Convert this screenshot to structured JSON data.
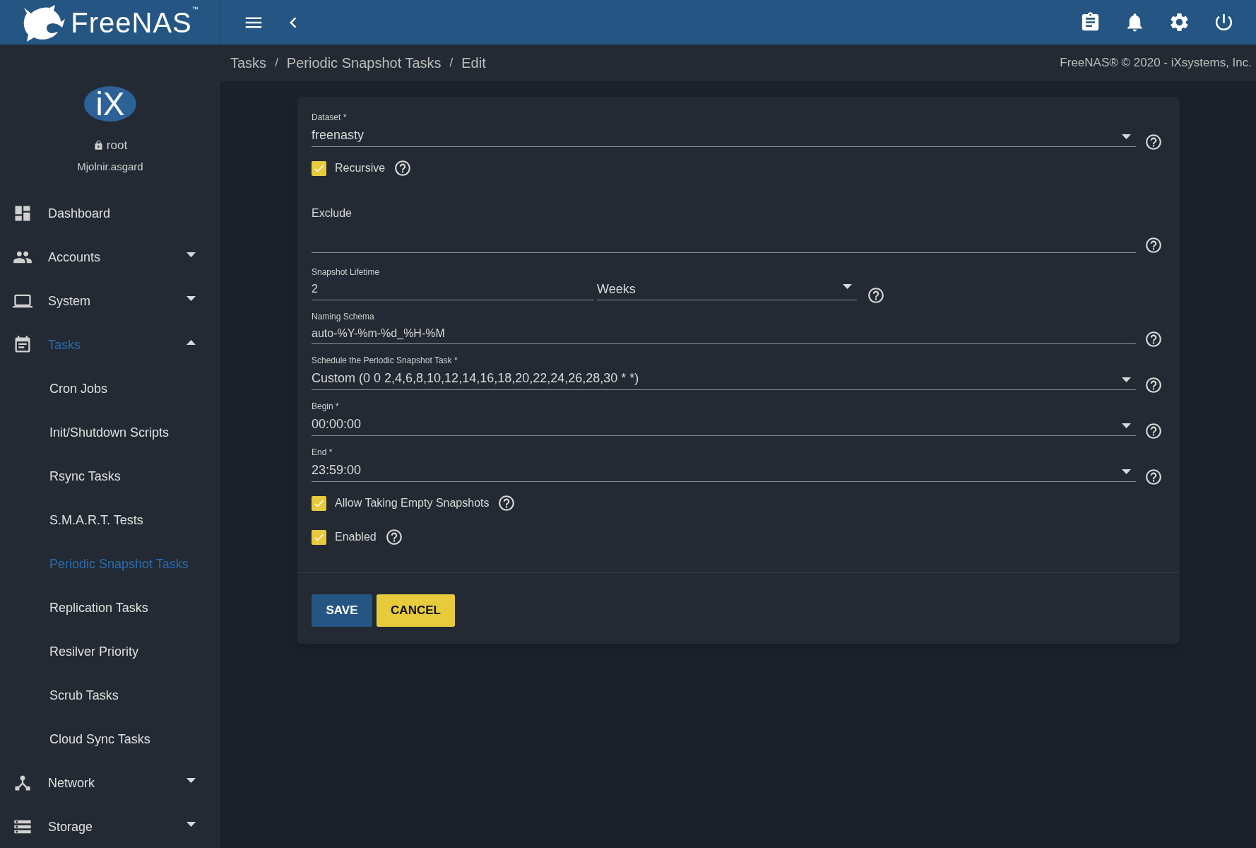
{
  "header": {
    "brand": "FreeNAS",
    "trademark": "™"
  },
  "breadcrumb": {
    "items": [
      "Tasks",
      "Periodic Snapshot Tasks",
      "Edit"
    ],
    "separator": "/",
    "copyright": "FreeNAS® © 2020 - iXsystems, Inc."
  },
  "user": {
    "logo": "iX",
    "name": "root",
    "host": "Mjolnir.asgard"
  },
  "sidebar": {
    "items": [
      {
        "label": "Dashboard",
        "selected": false
      },
      {
        "label": "Accounts",
        "selected": false,
        "expanded": false
      },
      {
        "label": "System",
        "selected": false,
        "expanded": false
      },
      {
        "label": "Tasks",
        "selected": true,
        "expanded": true,
        "children": [
          {
            "label": "Cron Jobs",
            "selected": false
          },
          {
            "label": "Init/Shutdown Scripts",
            "selected": false
          },
          {
            "label": "Rsync Tasks",
            "selected": false
          },
          {
            "label": "S.M.A.R.T. Tests",
            "selected": false
          },
          {
            "label": "Periodic Snapshot Tasks",
            "selected": true
          },
          {
            "label": "Replication Tasks",
            "selected": false
          },
          {
            "label": "Resilver Priority",
            "selected": false
          },
          {
            "label": "Scrub Tasks",
            "selected": false
          },
          {
            "label": "Cloud Sync Tasks",
            "selected": false
          }
        ]
      },
      {
        "label": "Network",
        "selected": false,
        "expanded": false
      },
      {
        "label": "Storage",
        "selected": false,
        "expanded": false
      }
    ]
  },
  "form": {
    "fields": [
      {
        "kind": "select",
        "label": "Dataset *",
        "value": "freenasty"
      },
      {
        "kind": "checkbox",
        "label": "Recursive",
        "checked": true
      },
      {
        "kind": "textarea",
        "label": "Exclude"
      },
      {
        "kind": "lifetime",
        "label": "Snapshot Lifetime",
        "value": "2",
        "unit": "Weeks"
      },
      {
        "kind": "input",
        "label": "Naming Schema",
        "value": "auto-%Y-%m-%d_%H-%M"
      },
      {
        "kind": "select",
        "label": "Schedule the Periodic Snapshot Task *",
        "value": "Custom (0 0 2,4,6,8,10,12,14,16,18,20,22,24,26,28,30 * *)"
      },
      {
        "kind": "select",
        "label": "Begin *",
        "value": "00:00:00"
      },
      {
        "kind": "select",
        "label": "End *",
        "value": "23:59:00"
      },
      {
        "kind": "checkbox",
        "label": "Allow Taking Empty Snapshots",
        "checked": true
      },
      {
        "kind": "checkbox",
        "label": "Enabled",
        "checked": true
      }
    ],
    "buttons": [
      {
        "kind": "primary",
        "label": "SAVE"
      },
      {
        "kind": "warning",
        "label": "CANCEL"
      }
    ]
  }
}
